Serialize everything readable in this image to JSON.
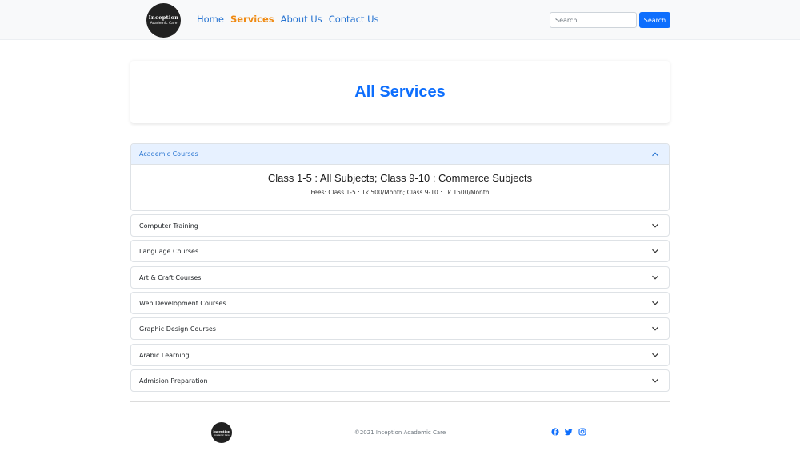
{
  "brand": {
    "logo_line1": "Inception",
    "logo_line2": "Academic Care"
  },
  "nav": {
    "links": [
      {
        "label": "Home",
        "active": false
      },
      {
        "label": "Services",
        "active": true
      },
      {
        "label": "About Us",
        "active": false
      },
      {
        "label": "Contact Us",
        "active": false
      }
    ],
    "search": {
      "placeholder": "Search",
      "value": "",
      "button_label": "Search"
    }
  },
  "page_title": "All Services",
  "accordion": [
    {
      "label": "Academic Courses",
      "expanded": true,
      "body_title": "Class 1-5 : All Subjects; Class 9-10 : Commerce Subjects",
      "body_text": "Fees: Class 1-5 : Tk.500/Month; Class 9-10 : Tk.1500/Month"
    },
    {
      "label": "Computer Training",
      "expanded": false
    },
    {
      "label": "Language Courses",
      "expanded": false
    },
    {
      "label": "Art & Craft Courses",
      "expanded": false
    },
    {
      "label": "Web Development Courses",
      "expanded": false
    },
    {
      "label": "Graphic Design Courses",
      "expanded": false
    },
    {
      "label": "Arabic Learning",
      "expanded": false
    },
    {
      "label": "Admision Preparation",
      "expanded": false
    }
  ],
  "footer": {
    "copyright": "©2021 Inception Academic Care",
    "socials": [
      "facebook-icon",
      "twitter-icon",
      "instagram-icon"
    ]
  },
  "colors": {
    "primary": "#0d6efd",
    "active_nav": "#ef8a12",
    "link": "#2774d1",
    "accordion_open_bg": "#e7f1ff"
  }
}
